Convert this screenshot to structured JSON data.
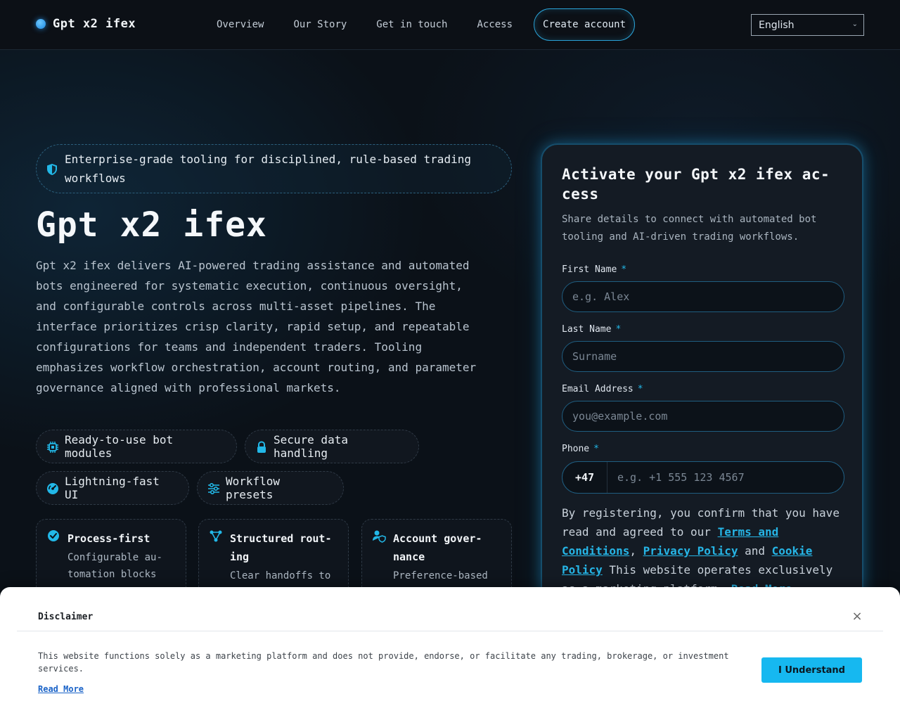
{
  "header": {
    "brand": "Gpt x2 ifex",
    "nav": [
      "Overview",
      "Our Story",
      "Get in touch",
      "Access"
    ],
    "cta": "Create account",
    "language": "English"
  },
  "hero": {
    "badge": "Enterprise-grade tooling for disciplined, rule-based trading workflows",
    "title": "Gpt x2 ifex",
    "description": "Gpt x2 ifex delivers AI-powered trading assistance and auto­mated bots engineered for systematic execution, continuous oversight, and configurable controls across multi-asset pipe­lines. The interface prioritizes crisp clarity, rapid setup, and repeatable configurations for teams and independent traders. Tooling emphasizes workflow orchestration, account routing, and parameter governance aligned with professional markets.",
    "chips": [
      {
        "label": "Ready-to-use bot modules",
        "icon": "chip-icon"
      },
      {
        "label": "Secure data handling",
        "icon": "lock-icon"
      },
      {
        "label": "Lightning-fast UI",
        "icon": "gauge-icon"
      },
      {
        "label": "Workflow presets",
        "icon": "sliders-icon"
      }
    ],
    "features": [
      {
        "title": "Process-first",
        "desc": "Configurable au­tomation blocks",
        "icon": "check-circle-icon"
      },
      {
        "title": "Structured rout­ing",
        "desc": "Clear handoffs to",
        "icon": "route-icon"
      },
      {
        "title": "Account gover­nance",
        "desc": "Preference-based",
        "icon": "user-shield-icon"
      }
    ]
  },
  "form": {
    "title": "Activate your Gpt x2 ifex ac­cess",
    "subtitle": "Share details to connect with automated bot tooling and AI-driven trading workflows.",
    "first_name_label": "First Name",
    "first_name_placeholder": "e.g. Alex",
    "last_name_label": "Last Name",
    "last_name_placeholder": "Surname",
    "email_label": "Email Address",
    "email_placeholder": "you@example.com",
    "phone_label": "Phone",
    "phone_code": "+47",
    "phone_placeholder": "e.g. +1 555 123 4567",
    "required_mark": "*",
    "consent_prefix": "By registering, you confirm that you have read and agreed to our ",
    "terms_link": "Terms and Conditions",
    "comma": ", ",
    "privacy_link": "Privacy Policy",
    "and": " and ",
    "cookie_link": "Cookie Policy",
    "consent_suffix": " This website operates exclusively as a marketing platform. ",
    "read_more": "Read More"
  },
  "disclaimer": {
    "title": "Disclaimer",
    "close": "×",
    "text": "This website functions solely as a marketing platform and does not provide, endorse, or facilitate any trading, brokerage, or investment services.",
    "read_more": "Read More",
    "button": "I Understand"
  },
  "colors": {
    "accent": "#22b8e8",
    "background": "#0b1118",
    "card": "#141b24",
    "button": "#16b8f0"
  }
}
